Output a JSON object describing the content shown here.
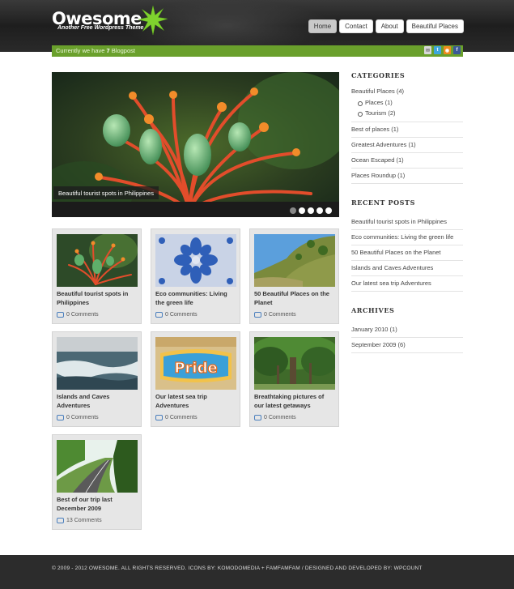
{
  "header": {
    "logo": "Owesome",
    "tagline": "Another Free Wordpress Theme",
    "nav": [
      "Home",
      "Contact",
      "About",
      "Beautiful Places"
    ]
  },
  "bar": {
    "prefix": "Currently we have ",
    "count": "7",
    "suffix": " Blogpost",
    "social": [
      "email-icon",
      "twitter-icon",
      "rss-icon",
      "facebook-icon"
    ]
  },
  "slider": {
    "caption": "Beautiful tourist spots in Philippines",
    "dots": 5,
    "active_dot": 0
  },
  "posts": [
    {
      "title": "Beautiful tourist spots in Philippines",
      "comments": "0 Comments",
      "thumb": "flower"
    },
    {
      "title": "Eco communities: Living the green life",
      "comments": "0 Comments",
      "thumb": "tile"
    },
    {
      "title": "50 Beautiful Places on the Planet",
      "comments": "0 Comments",
      "thumb": "hill"
    },
    {
      "title": "Islands and Caves Adventures",
      "comments": "0 Comments",
      "thumb": "sea"
    },
    {
      "title": "Our latest sea trip Adventures",
      "comments": "0 Comments",
      "thumb": "pride"
    },
    {
      "title": "Breathtaking pictures of our latest getaways",
      "comments": "0 Comments",
      "thumb": "tree"
    },
    {
      "title": "Best of our trip last December 2009",
      "comments": "13 Comments",
      "thumb": "road"
    }
  ],
  "sidebar": {
    "categories_title": "CATEGORIES",
    "categories": {
      "beautiful": "Beautiful Places (4)",
      "places": "Places (1)",
      "tourism": "Tourism (2)",
      "best": "Best of places (1)",
      "greatest": "Greatest Adventures (1)",
      "ocean": "Ocean Escaped (1)",
      "roundup": "Places Roundup (1)"
    },
    "recent_title": "RECENT POSTS",
    "recent": [
      "Beautiful tourist spots in Philippines",
      "Eco communities: Living the green life",
      "50 Beautiful Places on the Planet",
      "Islands and Caves Adventures",
      "Our latest sea trip Adventures"
    ],
    "archives_title": "ARCHIVES",
    "archives": [
      "January 2010 (1)",
      "September 2009 (6)"
    ]
  },
  "footer": {
    "text": "© 2009 - 2012 OWESOME. ALL RIGHTS RESERVED. ICONS BY: KOMODOMEDIA + FAMFAMFAM / DESIGNED AND DEVELOPED BY: WPCOUNT"
  },
  "colors": {
    "accent_green": "#6aa02c",
    "header_dark": "#1e1e1e",
    "post_bg": "#e6e6e6",
    "footer_bg": "#2c2c2c"
  }
}
